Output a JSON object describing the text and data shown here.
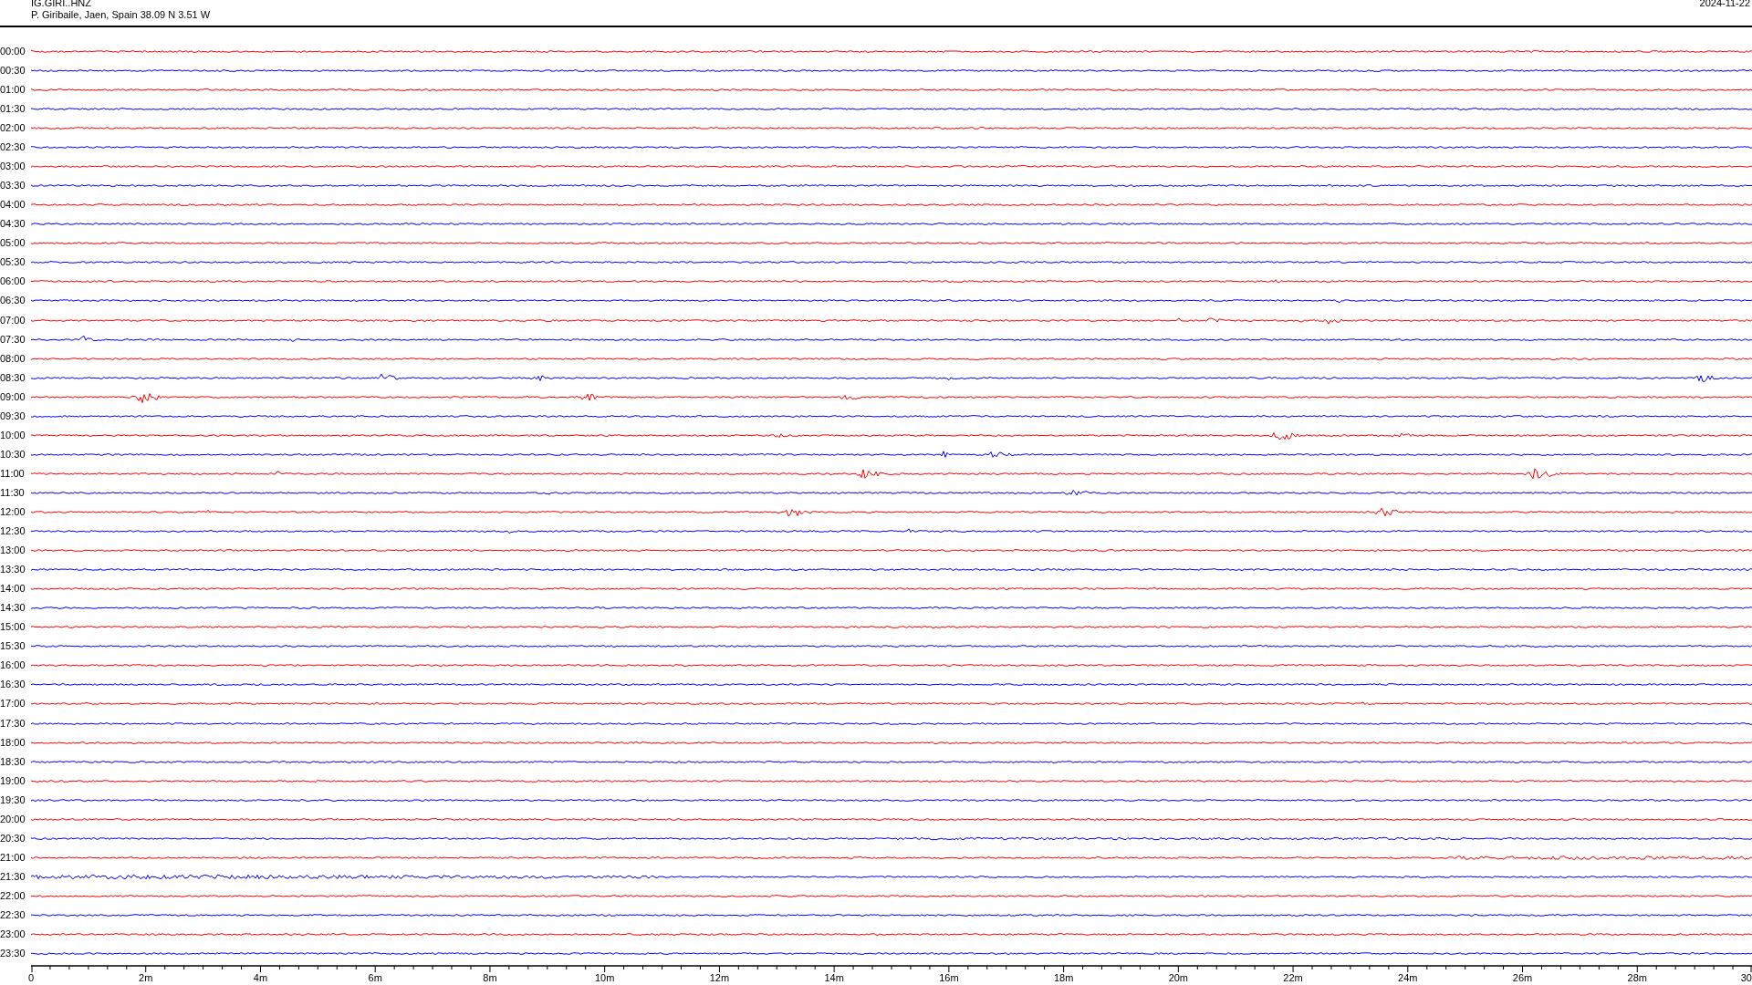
{
  "header": {
    "station": "IG.GIRI..HNZ",
    "location": "P. Giribaile, Jaen, Spain  38.09 N 3.51 W",
    "date": "2024-11-22"
  },
  "rows": [
    {
      "time": "00:00",
      "color": "#ff0000"
    },
    {
      "time": "00:30",
      "color": "#0000ff"
    },
    {
      "time": "01:00",
      "color": "#ff0000"
    },
    {
      "time": "01:30",
      "color": "#0000ff"
    },
    {
      "time": "02:00",
      "color": "#ff0000"
    },
    {
      "time": "02:30",
      "color": "#0000ff"
    },
    {
      "time": "03:00",
      "color": "#ff0000"
    },
    {
      "time": "03:30",
      "color": "#0000ff"
    },
    {
      "time": "04:00",
      "color": "#ff0000"
    },
    {
      "time": "04:30",
      "color": "#0000ff"
    },
    {
      "time": "05:00",
      "color": "#ff0000"
    },
    {
      "time": "05:30",
      "color": "#0000ff"
    },
    {
      "time": "06:00",
      "color": "#ff0000"
    },
    {
      "time": "06:30",
      "color": "#0000ff"
    },
    {
      "time": "07:00",
      "color": "#ff0000"
    },
    {
      "time": "07:30",
      "color": "#0000ff"
    },
    {
      "time": "08:00",
      "color": "#ff0000"
    },
    {
      "time": "08:30",
      "color": "#0000ff"
    },
    {
      "time": "09:00",
      "color": "#ff0000"
    },
    {
      "time": "09:30",
      "color": "#0000ff"
    },
    {
      "time": "10:00",
      "color": "#ff0000"
    },
    {
      "time": "10:30",
      "color": "#0000ff"
    },
    {
      "time": "11:00",
      "color": "#ff0000"
    },
    {
      "time": "11:30",
      "color": "#0000ff"
    },
    {
      "time": "12:00",
      "color": "#ff0000"
    },
    {
      "time": "12:30",
      "color": "#0000ff"
    },
    {
      "time": "13:00",
      "color": "#ff0000"
    },
    {
      "time": "13:30",
      "color": "#0000ff"
    },
    {
      "time": "14:00",
      "color": "#ff0000"
    },
    {
      "time": "14:30",
      "color": "#0000ff"
    },
    {
      "time": "15:00",
      "color": "#ff0000"
    },
    {
      "time": "15:30",
      "color": "#0000ff"
    },
    {
      "time": "16:00",
      "color": "#ff0000"
    },
    {
      "time": "16:30",
      "color": "#0000ff"
    },
    {
      "time": "17:00",
      "color": "#ff0000"
    },
    {
      "time": "17:30",
      "color": "#0000ff"
    },
    {
      "time": "18:00",
      "color": "#ff0000"
    },
    {
      "time": "18:30",
      "color": "#0000ff"
    },
    {
      "time": "19:00",
      "color": "#ff0000"
    },
    {
      "time": "19:30",
      "color": "#0000ff"
    },
    {
      "time": "20:00",
      "color": "#ff0000"
    },
    {
      "time": "20:30",
      "color": "#0000ff"
    },
    {
      "time": "21:00",
      "color": "#ff0000"
    },
    {
      "time": "21:30",
      "color": "#0000ff"
    },
    {
      "time": "22:00",
      "color": "#ff0000"
    },
    {
      "time": "22:30",
      "color": "#0000ff"
    },
    {
      "time": "23:00",
      "color": "#ff0000"
    },
    {
      "time": "23:30",
      "color": "#0000ff"
    }
  ],
  "x_axis": {
    "ticks": [
      "0",
      "2m",
      "4m",
      "6m",
      "8m",
      "10m",
      "12m",
      "14m",
      "16m",
      "18m",
      "20m",
      "22m",
      "24m",
      "26m",
      "28m",
      "30"
    ]
  }
}
